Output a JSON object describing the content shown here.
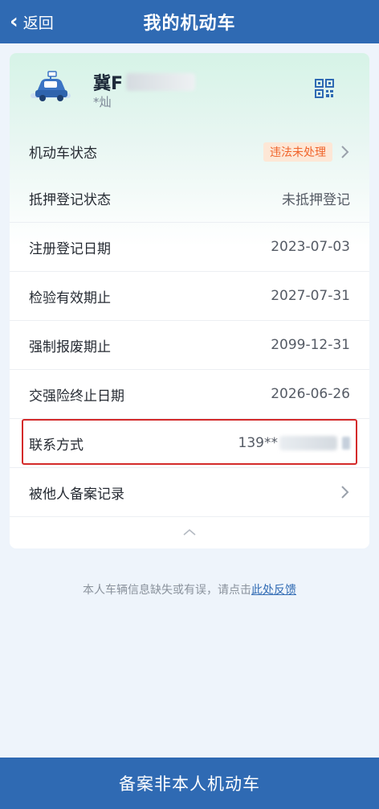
{
  "header": {
    "back_label": "返回",
    "title": "我的机动车"
  },
  "vehicle": {
    "plate_prefix": "冀F",
    "owner": "*灿"
  },
  "rows": [
    {
      "label": "机动车状态",
      "badge": "违法未处理",
      "has_arrow": true
    },
    {
      "label": "抵押登记状态",
      "value": "未抵押登记"
    },
    {
      "label": "注册登记日期",
      "value": "2023-07-03"
    },
    {
      "label": "检验有效期止",
      "value": "2027-07-31"
    },
    {
      "label": "强制报废期止",
      "value": "2099-12-31"
    },
    {
      "label": "交强险终止日期",
      "value": "2026-06-26"
    },
    {
      "label": "联系方式",
      "value": "139**"
    },
    {
      "label": "被他人备案记录",
      "has_arrow": true
    }
  ],
  "feedback": {
    "text": "本人车辆信息缺失或有误，请点击",
    "link": "此处反馈"
  },
  "bottom_button": "备案非本人机动车",
  "colors": {
    "primary": "#2f6ab3",
    "badge_bg": "#fde7d6",
    "badge_text": "#f0642b",
    "highlight_border": "#d42a2a"
  }
}
